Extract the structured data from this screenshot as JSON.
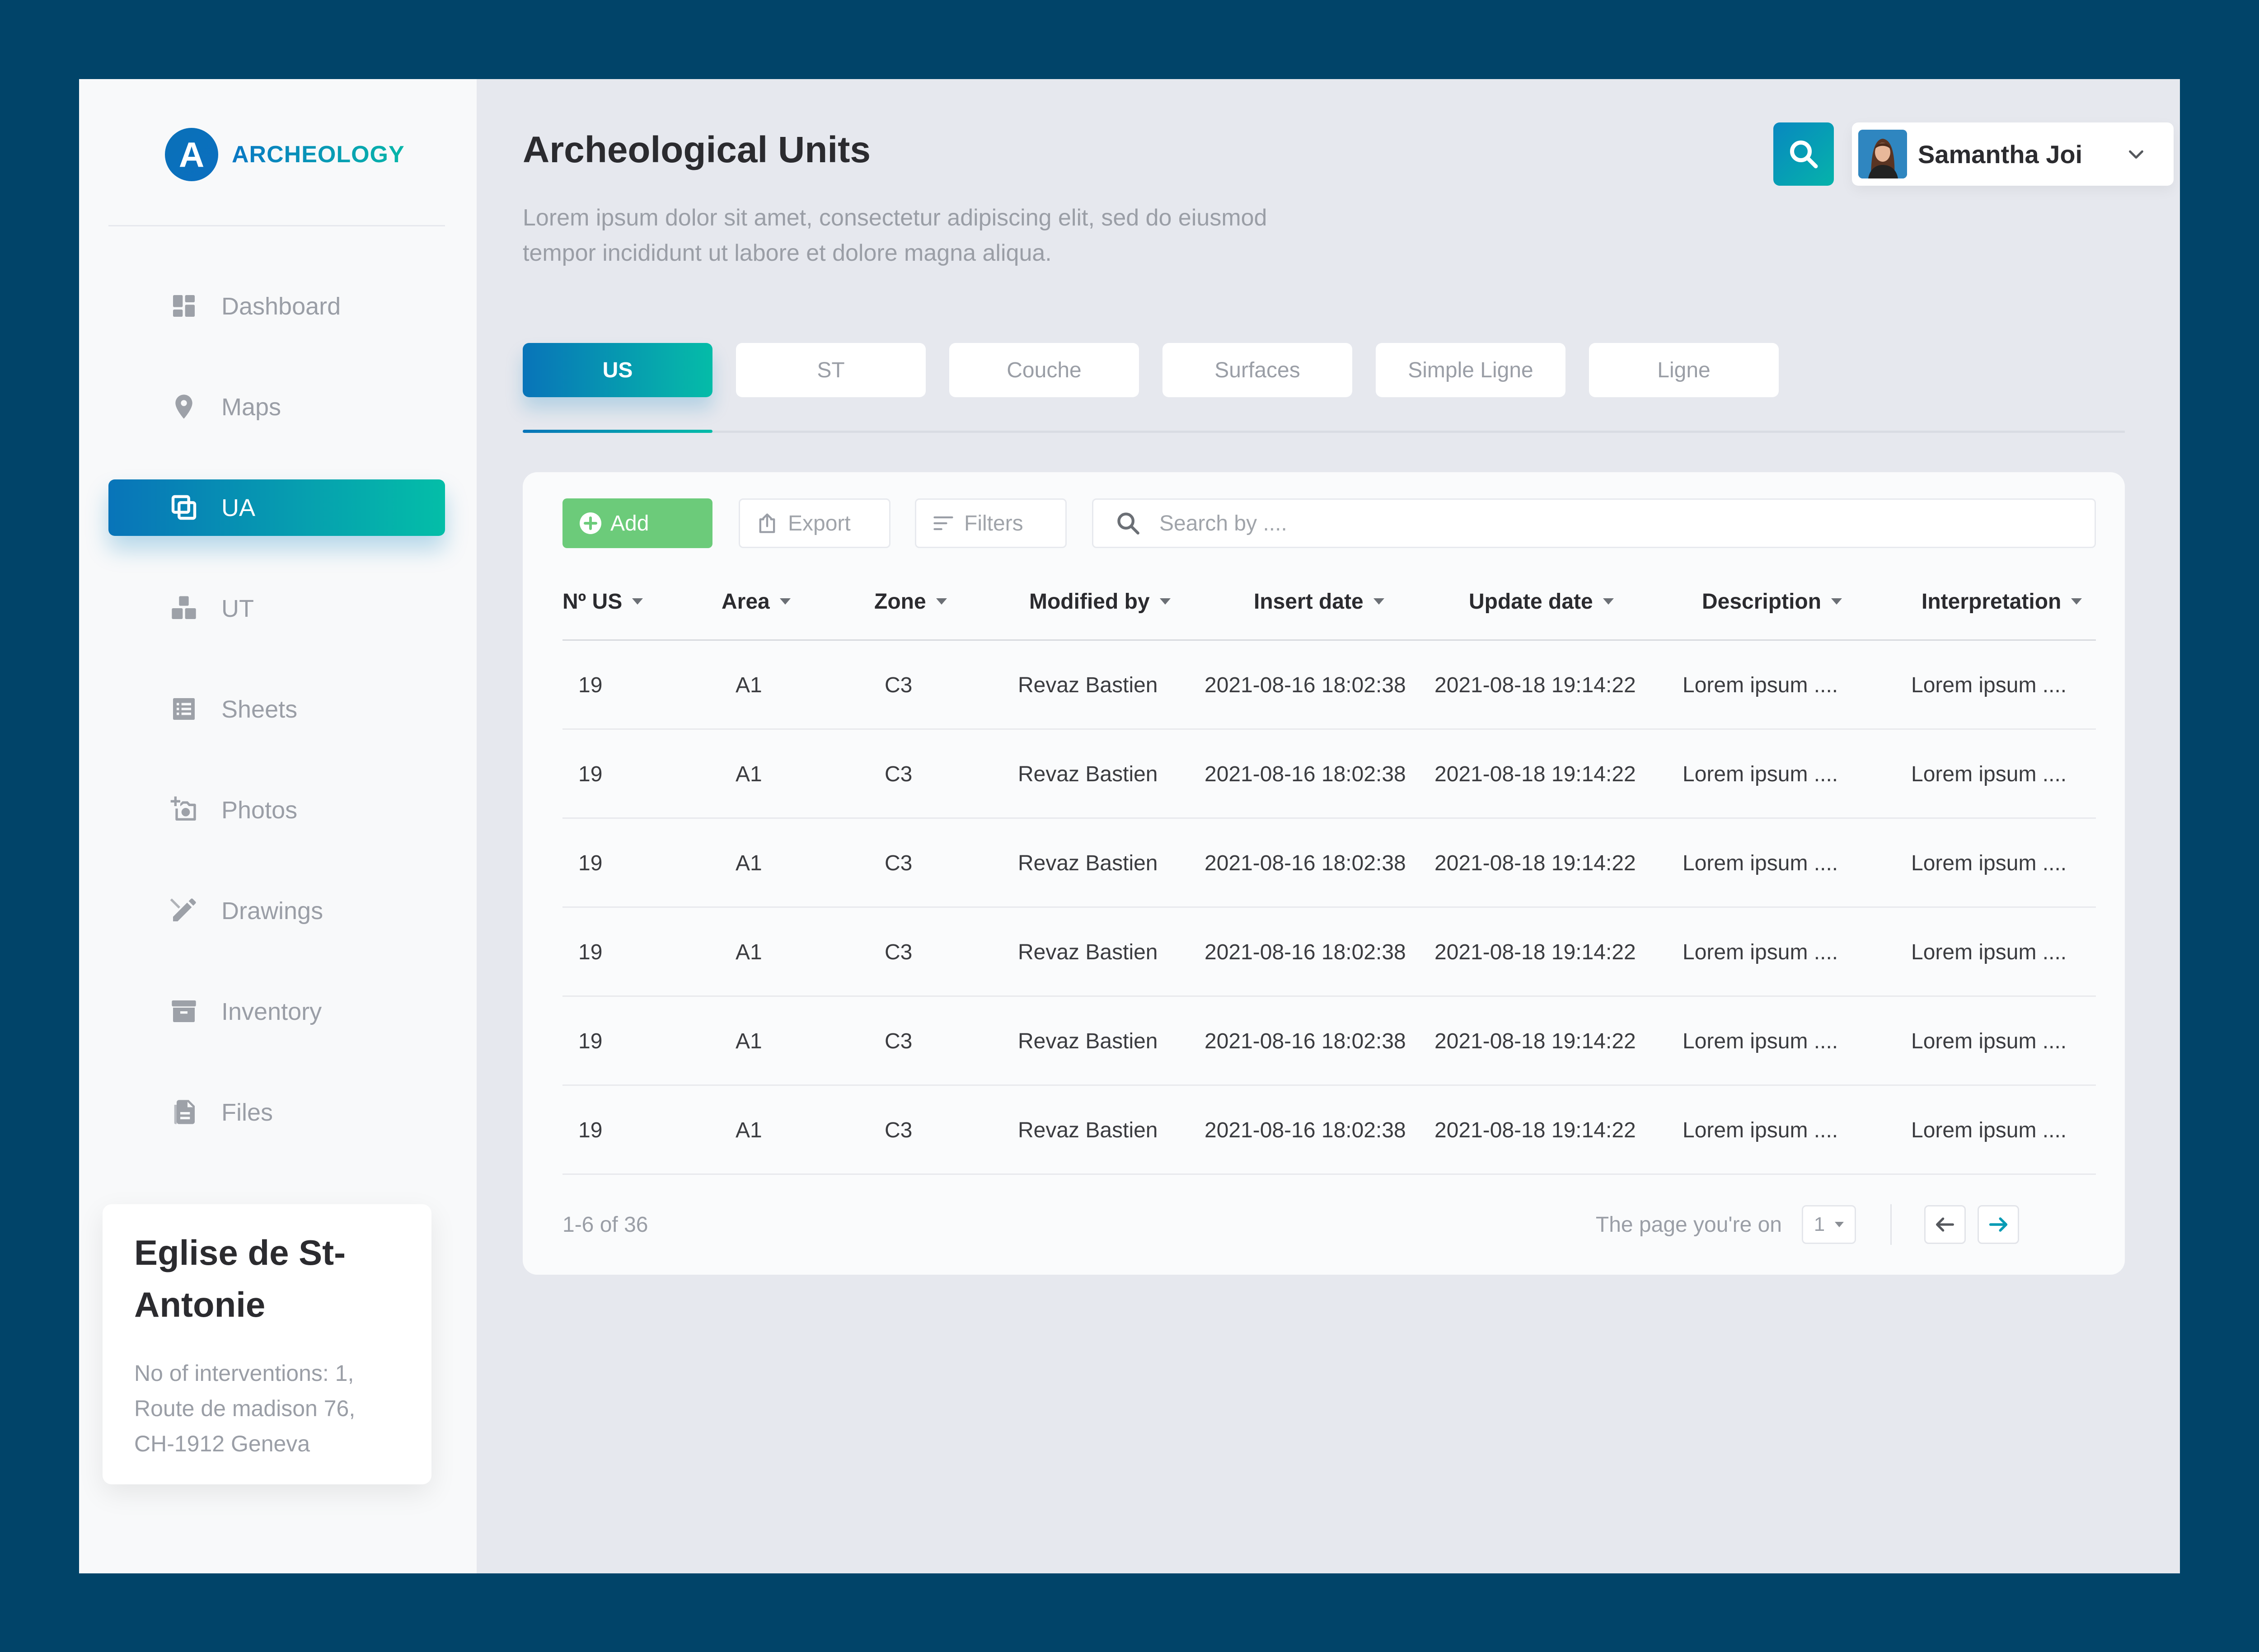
{
  "app": {
    "logo_letter": "A",
    "logo_text": "ARCHEOLOGY"
  },
  "colors": {
    "background": "#014469",
    "accent_start": "#0874b9",
    "accent_end": "#05bca8",
    "add_button": "#6ccb7a"
  },
  "sidebar": {
    "items": [
      {
        "label": "Dashboard",
        "icon": "dashboard-icon",
        "active": false
      },
      {
        "label": "Maps",
        "icon": "map-pin-icon",
        "active": false
      },
      {
        "label": "UA",
        "icon": "layers-icon",
        "active": true
      },
      {
        "label": "UT",
        "icon": "boxes-icon",
        "active": false
      },
      {
        "label": "Sheets",
        "icon": "list-icon",
        "active": false
      },
      {
        "label": "Photos",
        "icon": "camera-icon",
        "active": false
      },
      {
        "label": "Drawings",
        "icon": "pencil-icon",
        "active": false
      },
      {
        "label": "Inventory",
        "icon": "archive-icon",
        "active": false
      },
      {
        "label": "Files",
        "icon": "file-icon",
        "active": false
      }
    ],
    "site_card": {
      "title": "Eglise de St-Antonie",
      "details": "No of interventions: 1, Route de madison 76, CH-1912 Geneva"
    }
  },
  "header": {
    "title": "Archeological Units",
    "description": "Lorem ipsum dolor sit amet, consectetur adipiscing elit, sed do eiusmod tempor incididunt ut labore et dolore magna aliqua.",
    "user_name": "Samantha Joi"
  },
  "tabs": [
    {
      "label": "US",
      "active": true
    },
    {
      "label": "ST",
      "active": false
    },
    {
      "label": "Couche",
      "active": false
    },
    {
      "label": "Surfaces",
      "active": false
    },
    {
      "label": "Simple Ligne",
      "active": false
    },
    {
      "label": "Ligne",
      "active": false
    }
  ],
  "toolbar": {
    "add_label": "Add",
    "export_label": "Export",
    "filters_label": "Filters",
    "search_placeholder": "Search by ...."
  },
  "table": {
    "columns": [
      "Nº US",
      "Area",
      "Zone",
      "Modified by",
      "Insert date",
      "Update date",
      "Description",
      "Interpretation"
    ],
    "rows": [
      [
        "19",
        "A1",
        "C3",
        "Revaz Bastien",
        "2021-08-16  18:02:38",
        "2021-08-18  19:14:22",
        "Lorem ipsum ....",
        "Lorem ipsum ...."
      ],
      [
        "19",
        "A1",
        "C3",
        "Revaz Bastien",
        "2021-08-16  18:02:38",
        "2021-08-18  19:14:22",
        "Lorem ipsum ....",
        "Lorem ipsum ...."
      ],
      [
        "19",
        "A1",
        "C3",
        "Revaz Bastien",
        "2021-08-16  18:02:38",
        "2021-08-18  19:14:22",
        "Lorem ipsum ....",
        "Lorem ipsum ...."
      ],
      [
        "19",
        "A1",
        "C3",
        "Revaz Bastien",
        "2021-08-16  18:02:38",
        "2021-08-18  19:14:22",
        "Lorem ipsum ....",
        "Lorem ipsum ...."
      ],
      [
        "19",
        "A1",
        "C3",
        "Revaz Bastien",
        "2021-08-16  18:02:38",
        "2021-08-18  19:14:22",
        "Lorem ipsum ....",
        "Lorem ipsum ...."
      ],
      [
        "19",
        "A1",
        "C3",
        "Revaz Bastien",
        "2021-08-16  18:02:38",
        "2021-08-18  19:14:22",
        "Lorem ipsum ....",
        "Lorem ipsum ...."
      ]
    ]
  },
  "pagination": {
    "range": "1-6 of 36",
    "page_label": "The page you're on",
    "current_page": "1"
  }
}
